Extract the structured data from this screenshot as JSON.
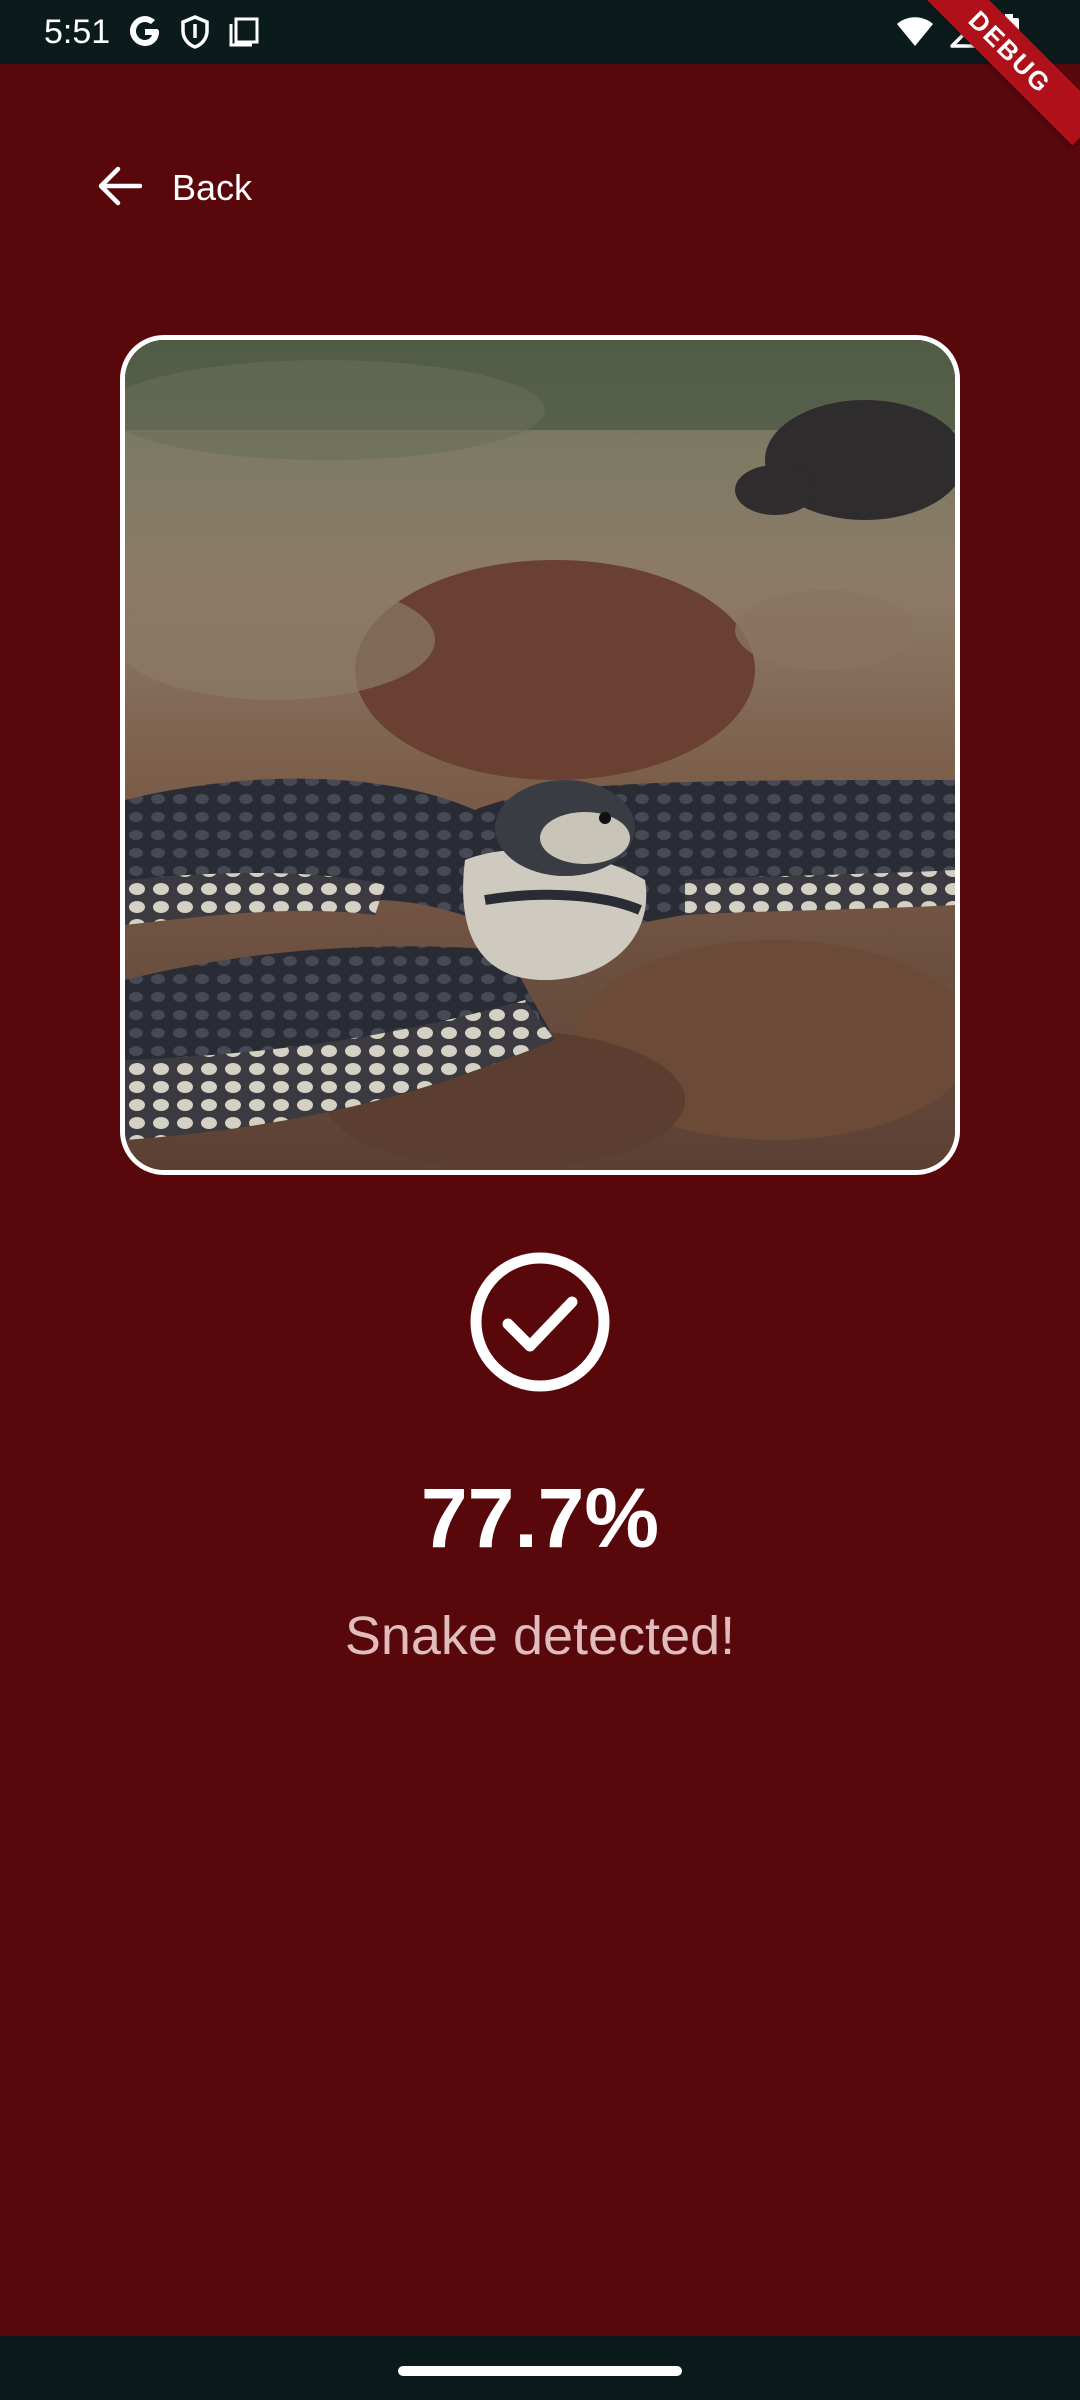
{
  "status_bar": {
    "time": "5:51",
    "icons_left": [
      "google-icon",
      "shield-icon",
      "screenshot-icon"
    ],
    "icons_right": [
      "wifi-icon",
      "signal-icon",
      "battery-icon"
    ]
  },
  "debug_banner": {
    "label": "DEBUG",
    "color": "#b0101a"
  },
  "header": {
    "back_label": "Back"
  },
  "result": {
    "image_alt": "snake photo",
    "status_icon": "check-circle-icon",
    "percentage": "77.7%",
    "message": "Snake detected!"
  },
  "colors": {
    "background": "#58070b",
    "system_bars": "#0b1b1b",
    "text_primary": "#ffffff",
    "text_secondary": "#e0bcbc"
  }
}
